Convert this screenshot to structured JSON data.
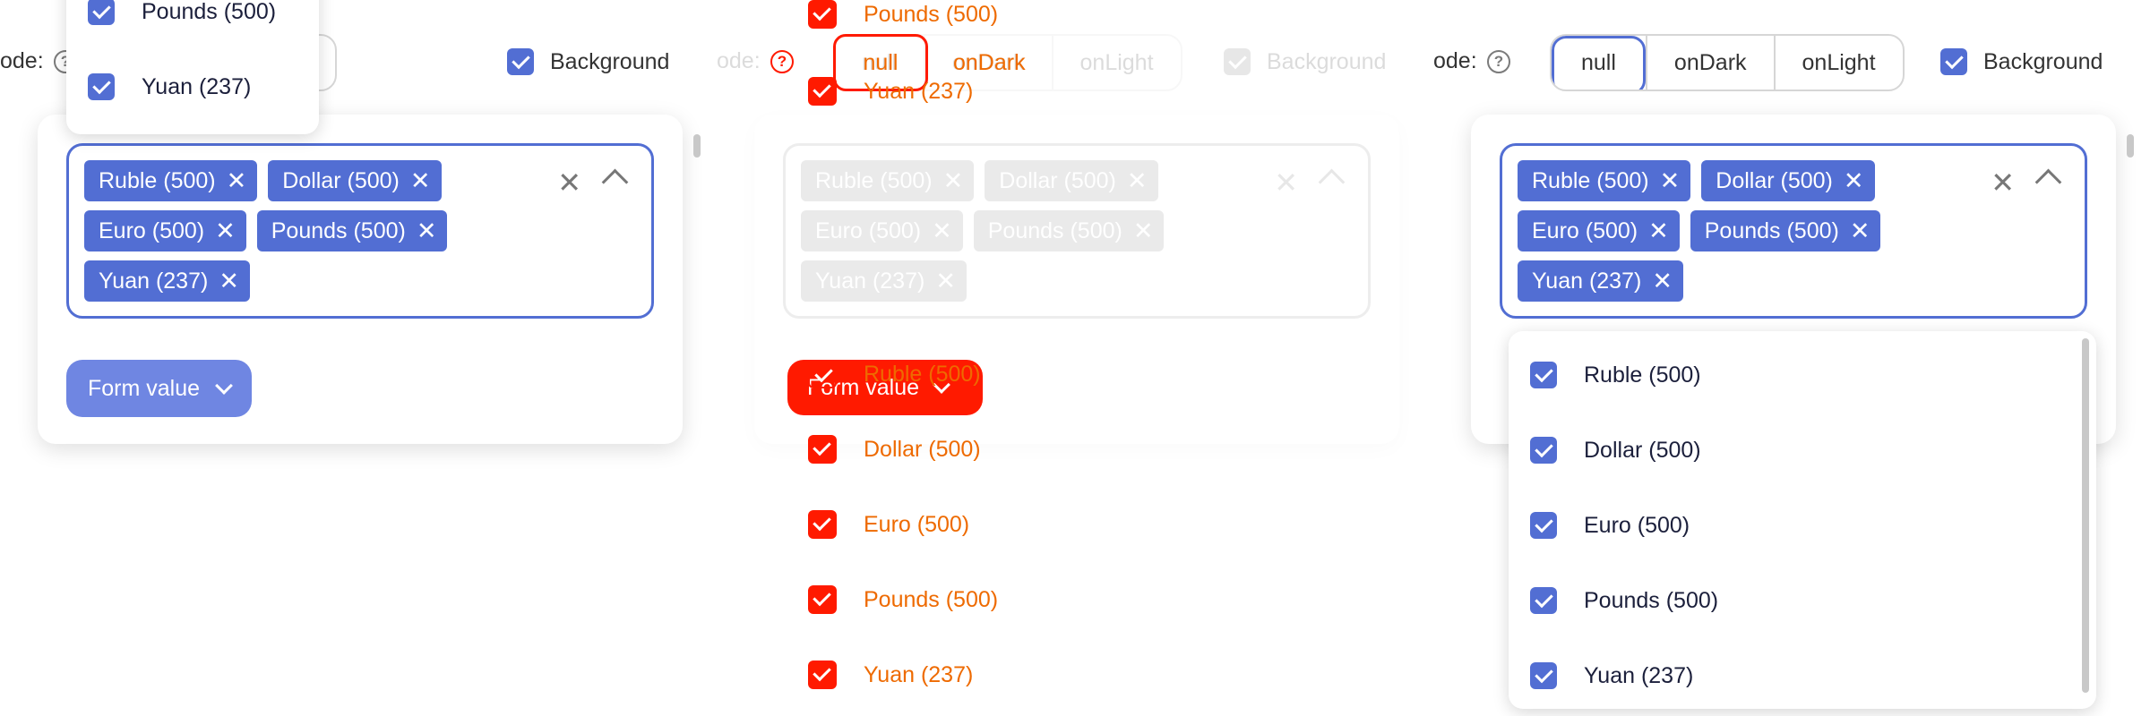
{
  "colors": {
    "accent": "#526ed3",
    "button": "#6f86e2",
    "highlight_red": "#ff1a00",
    "highlight_text": "#ee6a00"
  },
  "mode": {
    "label": "ode:",
    "options": [
      "null",
      "onDark",
      "onLight"
    ],
    "selected": "null",
    "background_label": "Background",
    "help_icon": "question-circle-icon"
  },
  "multiselect": {
    "tags": [
      "Ruble (500)",
      "Dollar (500)",
      "Euro (500)",
      "Pounds (500)",
      "Yuan (237)"
    ],
    "remove_icon": "close-icon",
    "clear_icon": "close-icon",
    "toggle_icon": "chevron-up-icon"
  },
  "form_value_button": "Form value",
  "dropdown": {
    "options": [
      "Ruble (500)",
      "Dollar (500)",
      "Euro (500)",
      "Pounds (500)",
      "Yuan (237)"
    ],
    "checked": [
      true,
      true,
      true,
      true,
      true
    ]
  }
}
